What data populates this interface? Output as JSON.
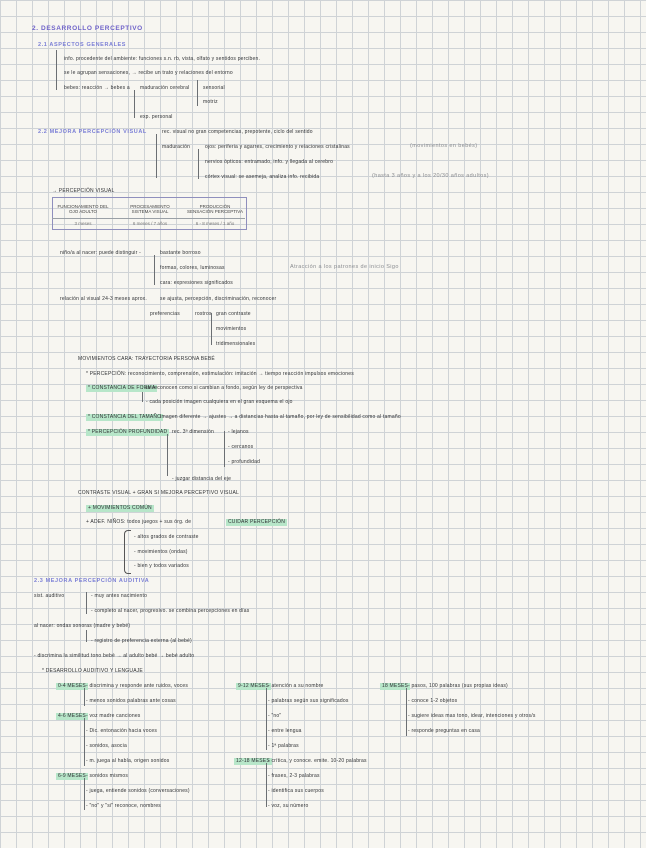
{
  "title": "2. DESARROLLO PERCEPTIVO",
  "s21": {
    "heading": "2.1 ASPECTOS GENERALES",
    "l1": "info. procedente del ambiente: funciones s.n. rb, vista, olfato y sentidos perciben.",
    "l2": "se le agrupan sensaciones, → recibe un trato y relaciones del entorno",
    "l3a": "bebes: reacción → bebes a",
    "l3b": "maduración cerebral",
    "l3c": "sensorial",
    "l4": "motriz",
    "l5": "exp. personal"
  },
  "s22": {
    "heading": "2.2 MEJORA PERCEPCIÓN VISUAL",
    "l1": "rec. visual no gran competencias, prepotente, ciclo del sentido",
    "l2a": "maduración",
    "l2b": "ojos: periferia y agarres, crecimiento y relaciones cristalinas",
    "l2c": "(movimientos en bebés)",
    "l3": "nervios ópticos: entramado, info. y llegada al cerebro",
    "l4a": "córtex visual: se asemeja, analiza info. recibida",
    "l4b": "(hasta 3 años y a los 20/30 años adultos)"
  },
  "table": {
    "label": "→ PERCEPCIÓN VISUAL",
    "headers": [
      "FUNCIONAMIENTO DEL OJO ADULTO",
      "PROCESAMIENTO SISTEMA VISUAL",
      "PRODUCCIÓN SENSACIÓN PERCEPTIVA"
    ],
    "values": [
      "3 meses",
      "6 meses / 7 años",
      "6 - 8 meses / 1 año"
    ]
  },
  "s23": {
    "l1": "niño/a al nacer: puede distinguir -",
    "l1b": "bastante borroso",
    "l2": "formas, colores, luminosas",
    "l3": "cara: expresiones significados",
    "note": "Atracción a los patrones de inicio Sigo",
    "l4": "relación al visual 24-3 meses aprox.",
    "l4b": "se ajusta, percepción, discriminación, reconocer",
    "l5a": "preferencias",
    "l5b": "rostros",
    "l5c": "gran contraste",
    "l6": "movimientos",
    "l7": "tridimensionales",
    "mov": "MOVIMIENTOS CARA: TRAYECTORIA PERSONA BEBÉ",
    "b1": "* PERCEPCIÓN: reconocimiento, comprensión, estimulación: imitación → tiempo reacción impulsos emociones",
    "b2a": "* CONSTANCIA DE FORMA",
    "b2b": ": se reconocen como si cambian a fondo, según ley de perspectiva",
    "b2c": "- cada posición imagen cualquiera en el gran esquema el ojo",
    "b3a": "* CONSTANCIA DEL TAMAÑO",
    "b3b": ": imagen diferente → ajustes → a distancias hasta al tamaño, por ley de sensibilidad como al tamaño",
    "b4a": "* PERCEPCIÓN PROFUNDIDAD",
    "b4b": "rec. 3ª dimensión",
    "b4c": "- lejanos",
    "b4d": "- cercanos",
    "b4e": "- profundidad",
    "b4f": "- juzgar distancia del eje",
    "concl": "CONTRASTE VISUAL + GRAN SI MEJORA PERCEPTIVO VISUAL",
    "c1": "+ MOVIMIENTOS COMÚN",
    "c2a": "+ ADEF. NIÑOS: todos juegos + sus órg. de",
    "c2b": "CUIDAR PERCEPCIÓN",
    "c3": "- altos grados de contraste",
    "c4": "- movimientos (ondas)",
    "c5": "- bien y todos variados"
  },
  "s24": {
    "heading": "2.3 MEJORA PERCEPCIÓN AUDITIVA",
    "l1a": "sist. auditivo",
    "l1b": "- muy antes nacimiento",
    "l2": "- completo al nacer, progresivo. se combina percepciones en días",
    "l3": "al nacer: ondas sonoras (madre y bebé)",
    "l4": "- registro de preferencia externa (al bebé)",
    "l5": "- discrimina la similitud tono bebé → al adulto bebé → bebé adulto",
    "l6": "* DESARROLLO AUDITIVO Y LENGUAJE"
  },
  "cols": {
    "a1": "0-4 MESES",
    "a1t": "- discrimina y responde ante ruidos, voces",
    "a2": "- menos sonidos palabras ante cosas",
    "a3": "4-6 MESES",
    "a3t": "- voz madre canciones",
    "a4": "- Dic. entonación hacia voces",
    "a5": "- sonidos, asocia",
    "a6": "- m. juega al habla, origen sonidos",
    "a7": "6-9 MESES",
    "a7t": "- sonidos mismos",
    "a8": "- juega, entiende sonidos (conversaciones)",
    "a9": "- \"no\" y \"si\" reconoce, nombres",
    "b1": "9-12 MESES",
    "b1t": "- atención a su nombre",
    "b2": "- palabras según sus significados",
    "b3": "- \"no\"",
    "b4": "- entre lengua",
    "b5": "- 1ª palabras",
    "b6": "12-18 MESES",
    "b6t": "- crítica, y conoce. emite. 10-20 palabras",
    "b7": "- frases, 2-3 palabras",
    "b8": "- identifica sus cuerpos",
    "b9": "- voz, su número",
    "c1": "18 MESES",
    "c1t": "- pasos, 100 palabras (sus propias ideas)",
    "c2": "- conoce 1-2 objetos",
    "c3": "- sugiere ideas mas tono, idear, intenciones y otros/s",
    "c4": "- responde preguntas en casa"
  }
}
